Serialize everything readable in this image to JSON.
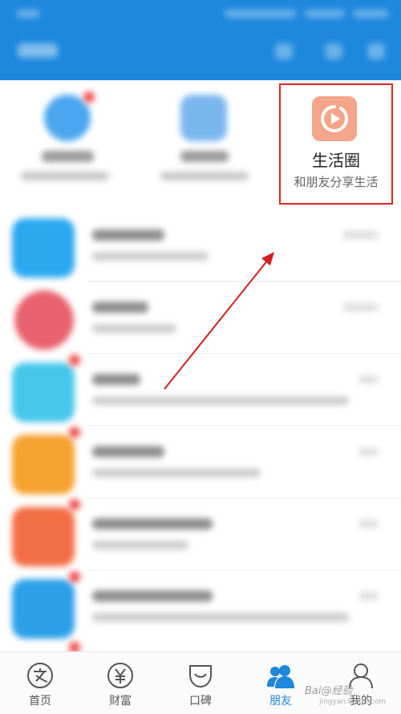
{
  "feature": {
    "life_circle_title": "生活圈",
    "life_circle_subtitle": "和朋友分享生活"
  },
  "tabs": [
    {
      "label": "首页",
      "icon": "alipay-home-icon"
    },
    {
      "label": "财富",
      "icon": "yen-coin-icon"
    },
    {
      "label": "口碑",
      "icon": "koubei-icon"
    },
    {
      "label": "朋友",
      "icon": "friends-icon",
      "active": true
    },
    {
      "label": "我的",
      "icon": "person-icon"
    }
  ],
  "watermark": {
    "text": "Bai@经验",
    "sub": "jingyan.baidu.com"
  },
  "colors": {
    "header": "#1e88dd",
    "accent": "#1e88dd",
    "highlight_box": "#e02323",
    "life_icon": "#f4a58a"
  }
}
